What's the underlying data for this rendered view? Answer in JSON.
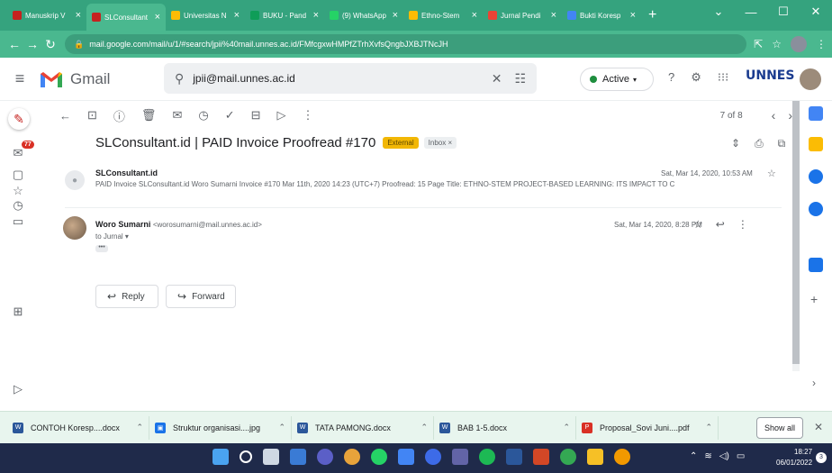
{
  "browser": {
    "tabs": [
      {
        "title": "Manuskrip V",
        "color": "#c5221f"
      },
      {
        "title": "SLConsultant",
        "color": "#c5221f",
        "active": true
      },
      {
        "title": "Universitas N",
        "color": "#fbbc04"
      },
      {
        "title": "BUKU - Pand",
        "color": "#0f9d58"
      },
      {
        "title": "(9) WhatsApp",
        "color": "#25d366"
      },
      {
        "title": "Ethno-Stem",
        "color": "#fbbc04"
      },
      {
        "title": "Jurnal Pendi",
        "color": "#ea4335"
      },
      {
        "title": "Bukti Koresp",
        "color": "#4285f4"
      }
    ],
    "new_tab": "+",
    "url": "mail.google.com/mail/u/1/#search/jpii%40mail.unnes.ac.id/FMfcgxwHMPfZTrhXvfsQngbJXBJTNcJH"
  },
  "gmail": {
    "product_name": "Gmail",
    "search_value": "jpii@mail.unnes.ac.id",
    "status_label": "Active",
    "org_logo_text": "UNNES",
    "unread_badge": "77",
    "pager_text": "7 of 8"
  },
  "thread": {
    "subject": "SLConsultant.id | PAID Invoice Proofread #170",
    "labels": {
      "external": "External",
      "inbox": "Inbox ×"
    },
    "messages": [
      {
        "sender": "SLConsultant.id",
        "snippet": "PAID Invoice SLConsultant.id Woro Sumarni Invoice #170 Mar 11th, 2020 14:23 (UTC+7) Proofread: 15 Page Title: ETHNO-STEM PROJECT-BASED LEARNING: ITS IMPACT TO C",
        "date": "Sat, Mar 14, 2020, 10:53 AM"
      },
      {
        "sender": "Woro Sumarni",
        "email": "<worosumarni@mail.unnes.ac.id>",
        "to": "to Jurnal ▾",
        "more": "•••",
        "date": "Sat, Mar 14, 2020, 8:28 PM"
      }
    ],
    "reply_label": "Reply",
    "forward_label": "Forward"
  },
  "downloads": {
    "items": [
      {
        "name": "CONTOH Koresp....docx",
        "color": "#2b579a",
        "glyph": "W"
      },
      {
        "name": "Struktur organisasi....jpg",
        "color": "#1a73e8",
        "glyph": "▣"
      },
      {
        "name": "TATA PAMONG.docx",
        "color": "#2b579a",
        "glyph": "W"
      },
      {
        "name": "BAB 1-5.docx",
        "color": "#2b579a",
        "glyph": "W"
      },
      {
        "name": "Proposal_Sovi Juni....pdf",
        "color": "#d93025",
        "glyph": "P"
      }
    ],
    "show_all": "Show all"
  },
  "taskbar": {
    "time": "18:27",
    "date": "06/01/2022",
    "notifications": "3"
  }
}
